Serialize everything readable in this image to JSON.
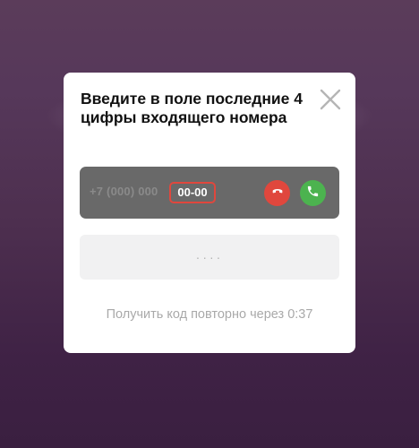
{
  "modal": {
    "title": "Введите в поле последние 4 цифры входящего номера",
    "close_icon": "close-icon"
  },
  "call": {
    "phone_prefix": "+7 (000) 000",
    "phone_suffix": "00-00",
    "decline_icon": "phone-hangup-icon",
    "accept_icon": "phone-icon",
    "decline_color": "#e0473d",
    "accept_color": "#4cb34f",
    "highlight_color": "#e0473d"
  },
  "code_input": {
    "placeholder": "····",
    "value": ""
  },
  "resend": {
    "text": "Получить код повторно через 0:37"
  }
}
